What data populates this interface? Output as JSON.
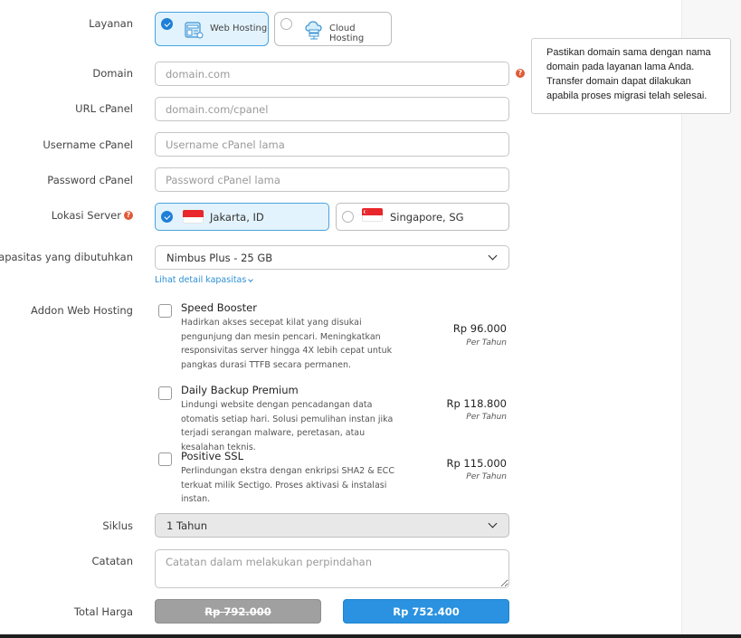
{
  "layanan": {
    "label": "Layanan",
    "options": [
      {
        "label": "Web Hosting",
        "icon": "web-hosting-icon",
        "selected": true
      },
      {
        "label": "Cloud Hosting",
        "icon": "cloud-hosting-icon",
        "selected": false
      }
    ]
  },
  "domain": {
    "label": "Domain",
    "placeholder": "domain.com",
    "value": ""
  },
  "tooltip": {
    "text": "Pastikan domain sama dengan nama domain pada layanan lama Anda. Transfer domain dapat dilakukan apabila proses migrasi telah selesai."
  },
  "url_cpanel": {
    "label": "URL cPanel",
    "placeholder": "domain.com/cpanel",
    "value": ""
  },
  "username_cpanel": {
    "label": "Username cPanel",
    "placeholder": "Username cPanel lama",
    "value": ""
  },
  "password_cpanel": {
    "label": "Password cPanel",
    "placeholder": "Password cPanel lama",
    "value": ""
  },
  "lokasi": {
    "label": "Lokasi Server",
    "options": [
      {
        "label": "Jakarta, ID",
        "flag": "indonesia-flag",
        "selected": true
      },
      {
        "label": "Singapore, SG",
        "flag": "singapore-flag",
        "selected": false
      }
    ]
  },
  "kapasitas": {
    "label": "Kapasitas yang dibutuhkan",
    "value": "Nimbus Plus - 25 GB",
    "detail_link": "Lihat detail kapasitas"
  },
  "addon": {
    "label": "Addon Web Hosting",
    "items": [
      {
        "title": "Speed Booster",
        "desc": "Hadirkan akses secepat kilat yang disukai pengunjung dan mesin pencari. Meningkatkan responsivitas server hingga 4X lebih cepat untuk pangkas durasi TTFB secara permanen.",
        "price": "Rp 96.000",
        "period": "Per Tahun",
        "checked": false
      },
      {
        "title": "Daily Backup Premium",
        "desc": "Lindungi website dengan pencadangan data otomatis setiap hari. Solusi pemulihan instan jika terjadi serangan malware, peretasan, atau kesalahan teknis.",
        "price": "Rp 118.800",
        "period": "Per Tahun",
        "checked": false
      },
      {
        "title": "Positive SSL",
        "desc": "Perlindungan ekstra dengan enkripsi SHA2 & ECC terkuat milik Sectigo. Proses aktivasi & instalasi instan.",
        "price": "Rp 115.000",
        "period": "Per Tahun",
        "checked": false
      }
    ]
  },
  "siklus": {
    "label": "Siklus",
    "value": "1 Tahun"
  },
  "catatan": {
    "label": "Catatan",
    "placeholder": "Catatan dalam melakukan perpindahan",
    "value": ""
  },
  "total": {
    "label": "Total Harga",
    "old_price": "Rp 792.000",
    "new_price": "Rp 752.400"
  },
  "colors": {
    "accent": "#2a92e0",
    "selected_bg": "#e2f3fd",
    "help_icon": "#e05a35"
  }
}
